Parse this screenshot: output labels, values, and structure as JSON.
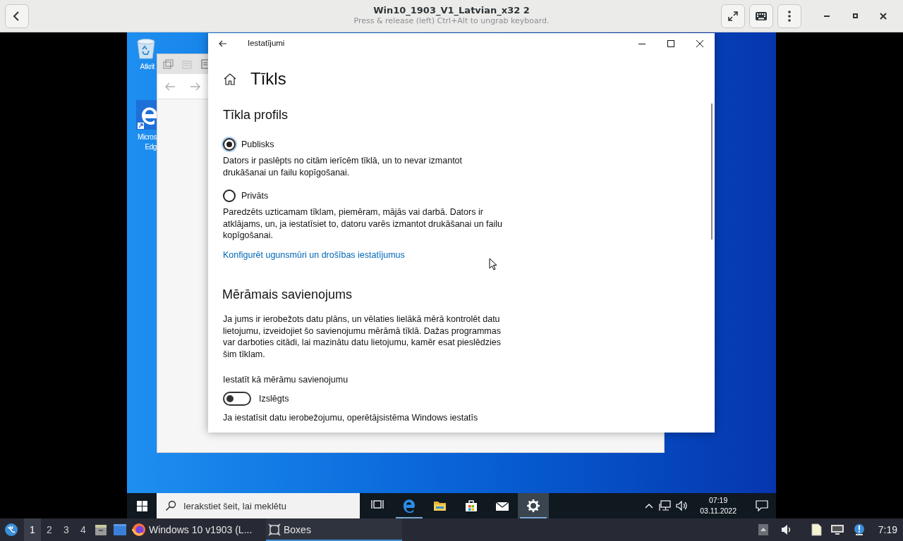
{
  "header": {
    "title": "Win10_1903_V1_Latvian_x32 2",
    "subtitle": "Press & release (left) Ctrl+Alt to ungrab keyboard."
  },
  "desktop_icons": [
    {
      "kind": "recycle-bin",
      "label": [
        "Atkrit"
      ]
    },
    {
      "kind": "edge",
      "label": [
        "Micros",
        "Edg"
      ]
    }
  ],
  "settings": {
    "window_title": "Iestatījumi",
    "page_title": "Tīkls",
    "profile": {
      "heading": "Tīkla profils",
      "options": [
        {
          "label": "Publisks",
          "description": "Dators ir paslēpts no citām ierīcēm tīklā, un to nevar izmantot drukāšanai un failu kopīgošanai.",
          "selected": true
        },
        {
          "label": "Privāts",
          "description": "Paredzēts uzticamam tīklam, piemēram, mājās vai darbā. Dators ir atklājams, un, ja iestatīsiet to, datoru varēs izmantot drukāšanai un failu kopīgošanai.",
          "selected": false
        }
      ],
      "link": "Konfigurēt ugunsmūri un drošības iestatījumus"
    },
    "metered": {
      "heading": "Mērāmais savienojums",
      "description": "Ja jums ir ierobežots datu plāns, un vēlaties lielākā mērā kontrolēt datu lietojumu, izveidojiet šo savienojumu mērāmā tīklā. Dažas programmas var darboties citādi, lai mazinātu datu lietojumu, kamēr esat pieslēdzies šim tīklam.",
      "toggle_label": "Iestatīt kā mērāmu savienojumu",
      "toggle": {
        "on": false,
        "state_text": "Izslēgts"
      },
      "footer_text": "Ja iestatīsit datu ierobežojumu, operētājsistēma Windows iestatīs"
    }
  },
  "taskbar": {
    "search_placeholder": "Ierakstiet šeit, lai meklētu",
    "apps": [
      {
        "kind": "task-view",
        "running": false,
        "selected": false
      },
      {
        "kind": "edge",
        "running": true,
        "selected": false
      },
      {
        "kind": "folder",
        "running": false,
        "selected": false
      },
      {
        "kind": "store",
        "running": false,
        "selected": false
      },
      {
        "kind": "mail",
        "running": false,
        "selected": false
      },
      {
        "kind": "settings",
        "running": true,
        "selected": true
      }
    ],
    "time": "07:19",
    "date": "03.11.2022"
  },
  "panel": {
    "workspaces": [
      {
        "label": "1",
        "selected": true
      },
      {
        "label": "2",
        "selected": false
      },
      {
        "label": "3",
        "selected": false
      },
      {
        "label": "4",
        "selected": false
      }
    ],
    "launchers": [
      {
        "kind": "file-manager"
      },
      {
        "kind": "window"
      }
    ],
    "tasks": [
      {
        "kind": "firefox",
        "label": "Windows 10 v1903 (L...",
        "selected": false
      },
      {
        "kind": "boxes",
        "label": "Boxes",
        "selected": true
      }
    ],
    "time": "7:19"
  }
}
